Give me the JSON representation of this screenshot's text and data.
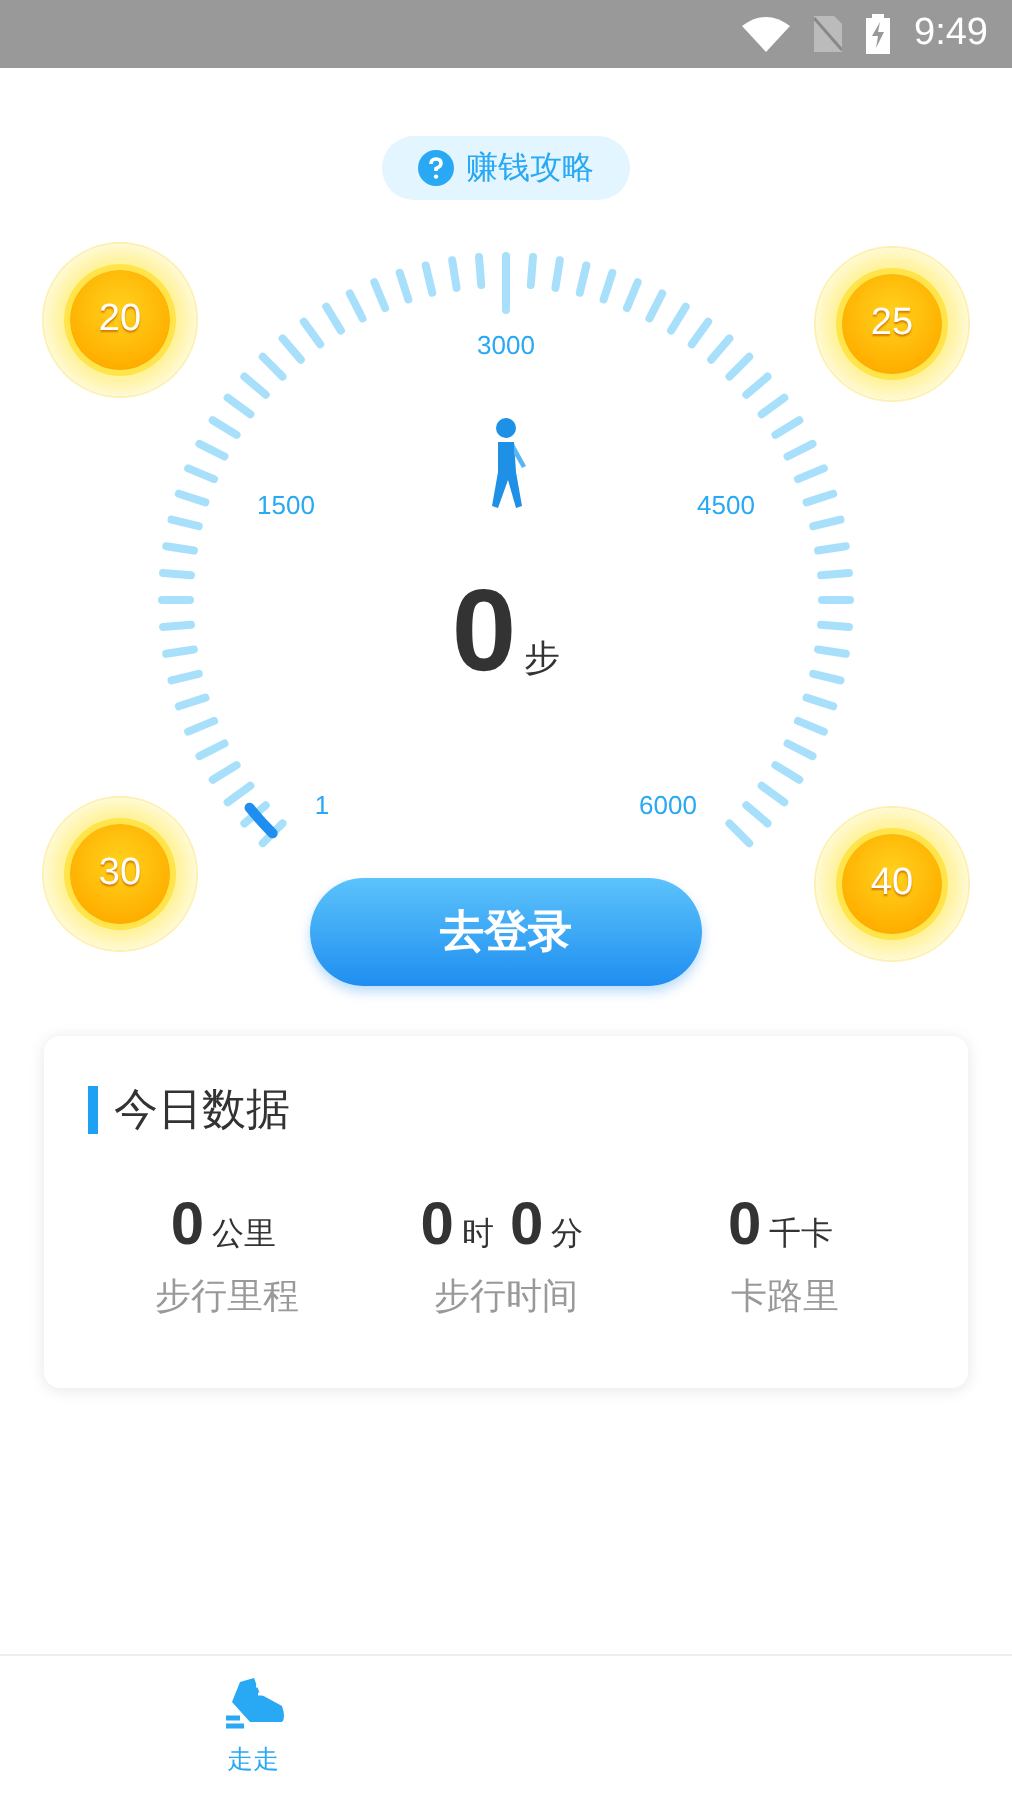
{
  "status_bar": {
    "time": "9:49"
  },
  "guide_button": {
    "label": "赚钱攻略"
  },
  "coins": [
    {
      "value": "20"
    },
    {
      "value": "25"
    },
    {
      "value": "30"
    },
    {
      "value": "40"
    }
  ],
  "gauge": {
    "scale_labels": [
      "1",
      "1500",
      "3000",
      "4500",
      "6000"
    ],
    "steps": "0",
    "unit": "步"
  },
  "login_button": {
    "label": "去登录"
  },
  "today_card": {
    "title": "今日数据",
    "stats": [
      {
        "parts": [
          {
            "value": "0",
            "unit": "公里"
          }
        ],
        "label": "步行里程"
      },
      {
        "parts": [
          {
            "value": "0",
            "unit": "时"
          },
          {
            "value": "0",
            "unit": "分"
          }
        ],
        "label": "步行时间"
      },
      {
        "parts": [
          {
            "value": "0",
            "unit": "千卡"
          }
        ],
        "label": "卡路里"
      }
    ]
  },
  "bottom_nav": [
    {
      "label": "走走",
      "selected": true
    }
  ]
}
